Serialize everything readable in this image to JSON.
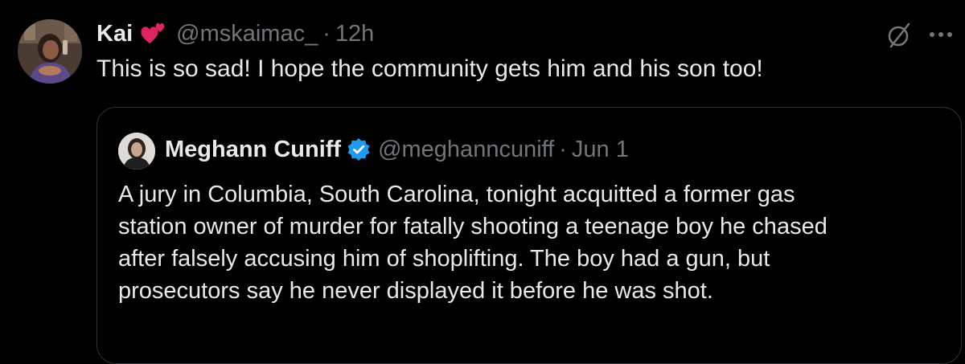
{
  "tweet": {
    "author": {
      "display_name": "Kai",
      "handle": "@mskaimac_",
      "time": "12h",
      "avatar_icon": "avatar-photo",
      "name_emoji": "two-hearts-emoji"
    },
    "separator": "·",
    "text": "This is so sad! I hope the community gets him and his son too!",
    "actions": {
      "grok_icon": "grok-icon",
      "more_icon": "more-icon"
    }
  },
  "quote": {
    "author": {
      "display_name": "Meghann Cuniff",
      "handle": "@meghanncuniff",
      "date": "Jun 1",
      "verified_icon": "verified-badge-icon",
      "verified_color": "#1d9bf0"
    },
    "separator": "·",
    "text_lines": [
      "A jury in Columbia, South Carolina, tonight acquitted a former gas",
      "station owner of murder for fatally shooting a teenage boy he chased",
      "after falsely accusing him of shoplifting. The boy had a gun, but",
      "prosecutors say he never displayed it before he was shot."
    ]
  },
  "colors": {
    "background": "#000000",
    "primary_text": "#e7e9ea",
    "secondary_text": "#71767b",
    "border": "#2f3336",
    "heart": "#e0245e"
  }
}
